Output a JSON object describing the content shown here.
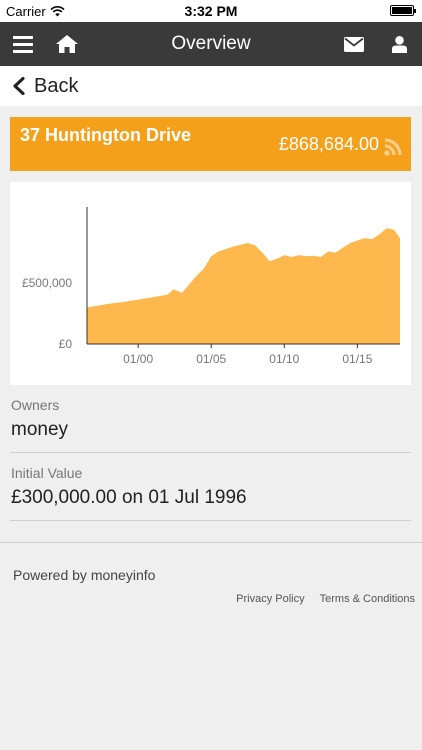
{
  "status_bar": {
    "carrier": "Carrier",
    "time": "3:32 PM",
    "wifi_icon": "wifi-icon",
    "battery_icon": "battery-icon"
  },
  "navbar": {
    "title": "Overview",
    "menu_icon": "menu-icon",
    "home_icon": "home-icon",
    "mail_icon": "mail-icon",
    "user_icon": "user-icon",
    "background": "#3a3a3a"
  },
  "back": {
    "label": "Back",
    "icon": "chevron-left-icon"
  },
  "property": {
    "name": "37 Huntington Drive",
    "value": "£868,684.00",
    "accent": "#f5a01a",
    "rss_icon": "rss-icon"
  },
  "chart_data": {
    "type": "area",
    "color": "#ffb84d",
    "y_tick_labels": [
      "£0",
      "£500,000"
    ],
    "x_tick_labels": [
      "01/00",
      "01/05",
      "01/10",
      "01/15"
    ],
    "ylim": [
      0,
      1150000
    ],
    "xlim": [
      "1996-07",
      "2017-12"
    ],
    "grid": false,
    "x": [
      "1996-07",
      "1997-01",
      "1998-01",
      "1999-01",
      "2000-01",
      "2001-01",
      "2002-01",
      "2002-06",
      "2003-01",
      "2003-06",
      "2004-01",
      "2004-07",
      "2005-01",
      "2005-07",
      "2006-01",
      "2006-07",
      "2007-01",
      "2007-07",
      "2008-01",
      "2008-07",
      "2009-01",
      "2009-07",
      "2010-01",
      "2010-07",
      "2011-01",
      "2011-07",
      "2012-01",
      "2012-07",
      "2013-01",
      "2013-07",
      "2014-01",
      "2014-07",
      "2015-01",
      "2015-07",
      "2016-01",
      "2016-07",
      "2017-01",
      "2017-07",
      "2017-12"
    ],
    "y": [
      300000,
      310000,
      330000,
      345000,
      365000,
      385000,
      405000,
      450000,
      420000,
      480000,
      560000,
      620000,
      720000,
      760000,
      780000,
      800000,
      815000,
      830000,
      810000,
      750000,
      680000,
      700000,
      730000,
      715000,
      730000,
      720000,
      725000,
      715000,
      760000,
      750000,
      790000,
      830000,
      850000,
      870000,
      860000,
      900000,
      950000,
      940000,
      868684
    ]
  },
  "owners": {
    "label": "Owners",
    "value": "money"
  },
  "initial_value": {
    "label": "Initial Value",
    "value": "£300,000.00 on 01 Jul 1996"
  },
  "footer": {
    "powered_by": "Powered by moneyinfo",
    "privacy": "Privacy Policy",
    "terms": "Terms & Conditions"
  }
}
